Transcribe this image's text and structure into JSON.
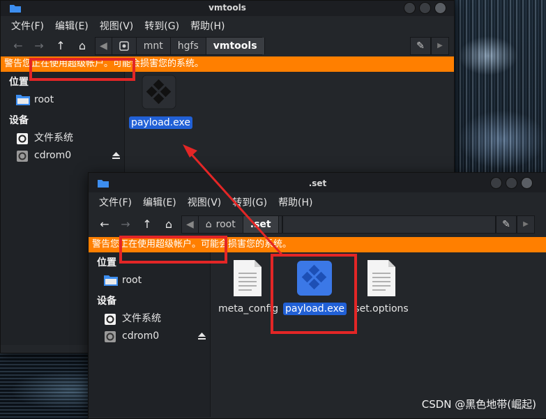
{
  "back_window": {
    "title": "vmtools",
    "menu": [
      "文件(F)",
      "编辑(E)",
      "视图(V)",
      "转到(G)",
      "帮助(H)"
    ],
    "path": [
      "mnt",
      "hgfs",
      "vmtools"
    ],
    "warning_prefix": "警告",
    "warning_highlight": "您正在使用超级帐户。",
    "warning_suffix": "可能会损害您的系统。",
    "sidebar": {
      "places_heading": "位置",
      "places": [
        {
          "label": "root",
          "icon": "folder-icon"
        }
      ],
      "devices_heading": "设备",
      "devices": [
        {
          "label": "文件系统",
          "icon": "drive-icon"
        },
        {
          "label": "cdrom0",
          "icon": "optical-drive-icon"
        }
      ]
    },
    "files": [
      {
        "name": "payload.exe",
        "icon": "exe-icon",
        "selected": true
      }
    ]
  },
  "front_window": {
    "title": ".set",
    "menu": [
      "文件(F)",
      "编辑(E)",
      "视图(V)",
      "转到(G)",
      "帮助(H)"
    ],
    "path": [
      "root",
      ".set"
    ],
    "warning_prefix": "警告",
    "warning_highlight": "您正在使用超级帐户。",
    "warning_suffix": "可能会损害您的系统。",
    "sidebar": {
      "places_heading": "位置",
      "places": [
        {
          "label": "root",
          "icon": "folder-icon"
        }
      ],
      "devices_heading": "设备",
      "devices": [
        {
          "label": "文件系统",
          "icon": "drive-icon"
        },
        {
          "label": "cdrom0",
          "icon": "optical-drive-icon"
        }
      ]
    },
    "files": [
      {
        "name": "meta_config",
        "icon": "text-file-icon",
        "selected": false
      },
      {
        "name": "payload.exe",
        "icon": "exe-icon",
        "selected": true
      },
      {
        "name": "set.options",
        "icon": "text-file-icon",
        "selected": false
      }
    ]
  },
  "watermark": "CSDN @黑色地带(崛起)",
  "colors": {
    "warning_bg": "#ff7f00",
    "selection": "#2160d6",
    "highlight_box": "#e32626",
    "window_bg": "#23262a"
  }
}
